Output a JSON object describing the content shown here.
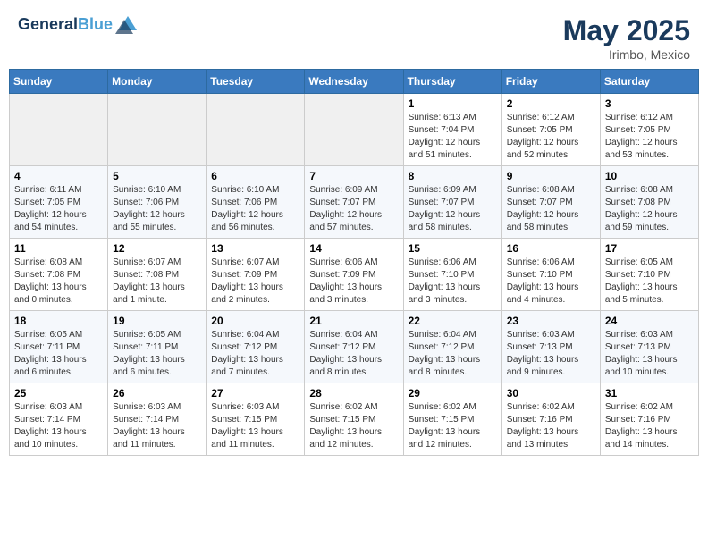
{
  "header": {
    "logo_general": "General",
    "logo_blue": "Blue",
    "month_year": "May 2025",
    "location": "Irimbo, Mexico"
  },
  "days_of_week": [
    "Sunday",
    "Monday",
    "Tuesday",
    "Wednesday",
    "Thursday",
    "Friday",
    "Saturday"
  ],
  "weeks": [
    [
      {
        "day": "",
        "info": ""
      },
      {
        "day": "",
        "info": ""
      },
      {
        "day": "",
        "info": ""
      },
      {
        "day": "",
        "info": ""
      },
      {
        "day": "1",
        "info": "Sunrise: 6:13 AM\nSunset: 7:04 PM\nDaylight: 12 hours and 51 minutes."
      },
      {
        "day": "2",
        "info": "Sunrise: 6:12 AM\nSunset: 7:05 PM\nDaylight: 12 hours and 52 minutes."
      },
      {
        "day": "3",
        "info": "Sunrise: 6:12 AM\nSunset: 7:05 PM\nDaylight: 12 hours and 53 minutes."
      }
    ],
    [
      {
        "day": "4",
        "info": "Sunrise: 6:11 AM\nSunset: 7:05 PM\nDaylight: 12 hours and 54 minutes."
      },
      {
        "day": "5",
        "info": "Sunrise: 6:10 AM\nSunset: 7:06 PM\nDaylight: 12 hours and 55 minutes."
      },
      {
        "day": "6",
        "info": "Sunrise: 6:10 AM\nSunset: 7:06 PM\nDaylight: 12 hours and 56 minutes."
      },
      {
        "day": "7",
        "info": "Sunrise: 6:09 AM\nSunset: 7:07 PM\nDaylight: 12 hours and 57 minutes."
      },
      {
        "day": "8",
        "info": "Sunrise: 6:09 AM\nSunset: 7:07 PM\nDaylight: 12 hours and 58 minutes."
      },
      {
        "day": "9",
        "info": "Sunrise: 6:08 AM\nSunset: 7:07 PM\nDaylight: 12 hours and 58 minutes."
      },
      {
        "day": "10",
        "info": "Sunrise: 6:08 AM\nSunset: 7:08 PM\nDaylight: 12 hours and 59 minutes."
      }
    ],
    [
      {
        "day": "11",
        "info": "Sunrise: 6:08 AM\nSunset: 7:08 PM\nDaylight: 13 hours and 0 minutes."
      },
      {
        "day": "12",
        "info": "Sunrise: 6:07 AM\nSunset: 7:08 PM\nDaylight: 13 hours and 1 minute."
      },
      {
        "day": "13",
        "info": "Sunrise: 6:07 AM\nSunset: 7:09 PM\nDaylight: 13 hours and 2 minutes."
      },
      {
        "day": "14",
        "info": "Sunrise: 6:06 AM\nSunset: 7:09 PM\nDaylight: 13 hours and 3 minutes."
      },
      {
        "day": "15",
        "info": "Sunrise: 6:06 AM\nSunset: 7:10 PM\nDaylight: 13 hours and 3 minutes."
      },
      {
        "day": "16",
        "info": "Sunrise: 6:06 AM\nSunset: 7:10 PM\nDaylight: 13 hours and 4 minutes."
      },
      {
        "day": "17",
        "info": "Sunrise: 6:05 AM\nSunset: 7:10 PM\nDaylight: 13 hours and 5 minutes."
      }
    ],
    [
      {
        "day": "18",
        "info": "Sunrise: 6:05 AM\nSunset: 7:11 PM\nDaylight: 13 hours and 6 minutes."
      },
      {
        "day": "19",
        "info": "Sunrise: 6:05 AM\nSunset: 7:11 PM\nDaylight: 13 hours and 6 minutes."
      },
      {
        "day": "20",
        "info": "Sunrise: 6:04 AM\nSunset: 7:12 PM\nDaylight: 13 hours and 7 minutes."
      },
      {
        "day": "21",
        "info": "Sunrise: 6:04 AM\nSunset: 7:12 PM\nDaylight: 13 hours and 8 minutes."
      },
      {
        "day": "22",
        "info": "Sunrise: 6:04 AM\nSunset: 7:12 PM\nDaylight: 13 hours and 8 minutes."
      },
      {
        "day": "23",
        "info": "Sunrise: 6:03 AM\nSunset: 7:13 PM\nDaylight: 13 hours and 9 minutes."
      },
      {
        "day": "24",
        "info": "Sunrise: 6:03 AM\nSunset: 7:13 PM\nDaylight: 13 hours and 10 minutes."
      }
    ],
    [
      {
        "day": "25",
        "info": "Sunrise: 6:03 AM\nSunset: 7:14 PM\nDaylight: 13 hours and 10 minutes."
      },
      {
        "day": "26",
        "info": "Sunrise: 6:03 AM\nSunset: 7:14 PM\nDaylight: 13 hours and 11 minutes."
      },
      {
        "day": "27",
        "info": "Sunrise: 6:03 AM\nSunset: 7:15 PM\nDaylight: 13 hours and 11 minutes."
      },
      {
        "day": "28",
        "info": "Sunrise: 6:02 AM\nSunset: 7:15 PM\nDaylight: 13 hours and 12 minutes."
      },
      {
        "day": "29",
        "info": "Sunrise: 6:02 AM\nSunset: 7:15 PM\nDaylight: 13 hours and 12 minutes."
      },
      {
        "day": "30",
        "info": "Sunrise: 6:02 AM\nSunset: 7:16 PM\nDaylight: 13 hours and 13 minutes."
      },
      {
        "day": "31",
        "info": "Sunrise: 6:02 AM\nSunset: 7:16 PM\nDaylight: 13 hours and 14 minutes."
      }
    ]
  ]
}
